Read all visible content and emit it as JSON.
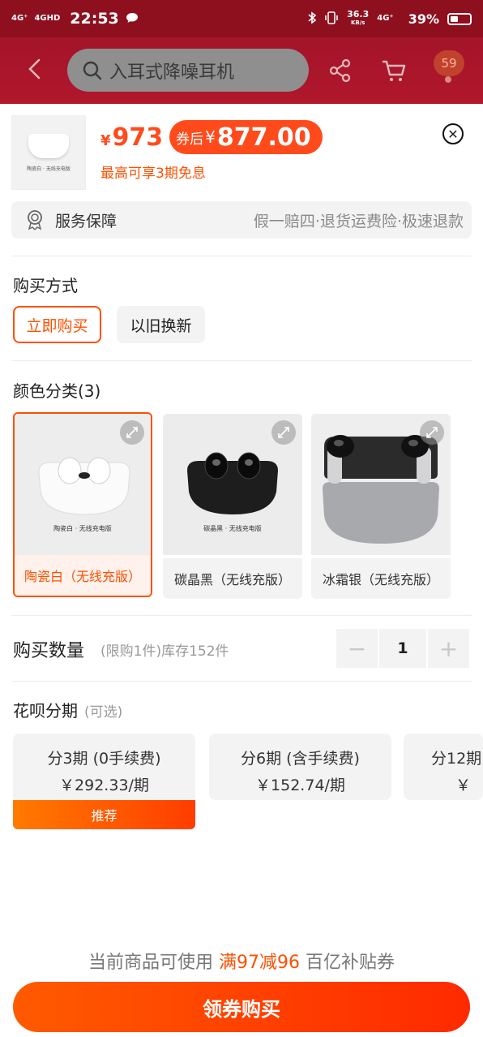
{
  "status_bar": {
    "signal_1": "4G⁺",
    "signal_2": "4GHD",
    "time": "22:53",
    "speed_value": "36.3",
    "speed_unit": "KB/s",
    "signal_3": "4G⁺",
    "battery": "39%",
    "battery_level": 0.39
  },
  "header": {
    "search_placeholder": "入耳式降噪耳机",
    "cart_badge": "59"
  },
  "product": {
    "thumb_caption": "陶瓷白 · 无线充电版",
    "price_symbol": "¥",
    "price": "973",
    "coupon_label": "券后",
    "coupon_symbol": "¥",
    "coupon_price": "877.00",
    "installment_note": "最高可享3期免息"
  },
  "service": {
    "title": "服务保障",
    "detail": "假一赔四·退货运费险·极速退款"
  },
  "purchase_method": {
    "title": "购买方式",
    "options": [
      "立即购买",
      "以旧换新"
    ]
  },
  "colors": {
    "title": "颜色分类(3)",
    "items": [
      {
        "label": "陶瓷白（无线充版）",
        "caption": "陶瓷白 · 无线充电版"
      },
      {
        "label": "碳晶黑（无线充版）",
        "caption": "碳晶黑 · 无线充电版"
      },
      {
        "label": "冰霜银（无线充版）",
        "caption": ""
      }
    ]
  },
  "quantity": {
    "title": "购买数量",
    "note": "(限购1件)库存152件",
    "minus": "−",
    "value": "1",
    "plus": "+"
  },
  "huabei": {
    "title": "花呗分期",
    "optional": "(可选)",
    "plans": [
      {
        "line1": "分3期 (0手续费)",
        "line2": "￥292.33/期"
      },
      {
        "line1": "分6期 (含手续费)",
        "line2": "￥152.74/期"
      },
      {
        "line1": "分12期",
        "line2": "￥"
      }
    ],
    "recommend": "推荐"
  },
  "footer": {
    "subsidy_prefix": "当前商品可使用",
    "subsidy_highlight": "满97减96",
    "subsidy_suffix": "百亿补贴券",
    "buy_button": "领券购买"
  }
}
